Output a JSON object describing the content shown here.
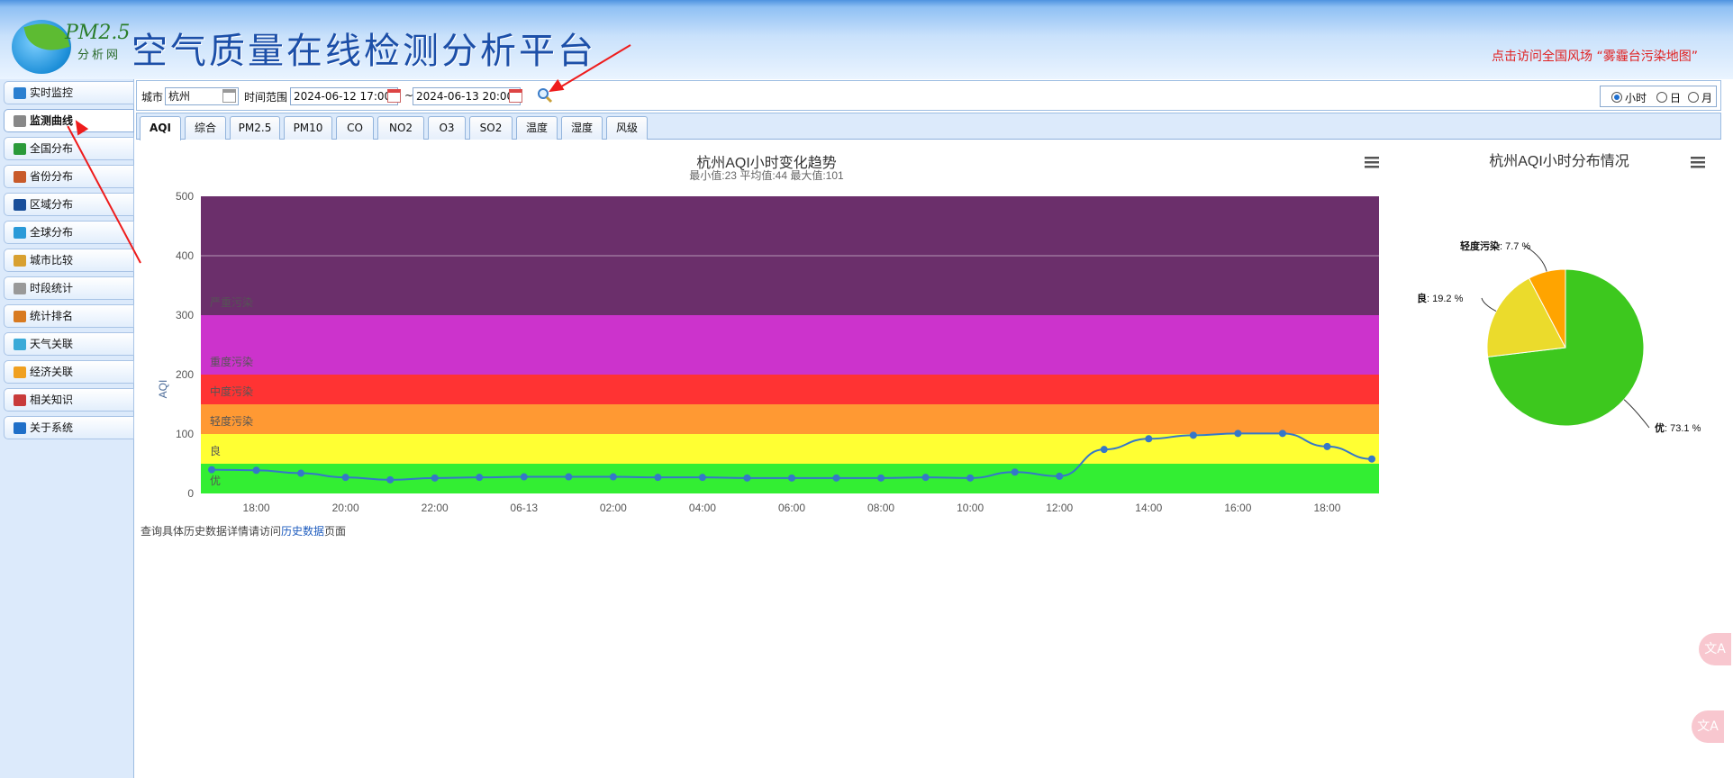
{
  "header": {
    "logo_pm": "PM2.5",
    "logo_sub": "分析网",
    "site_title": "空气质量在线检测分析平台",
    "marquee": "点击访问全国风场  “雾霾台污染地图”"
  },
  "sidebar": {
    "items": [
      {
        "label": "实时监控",
        "icon": "monitor-icon"
      },
      {
        "label": "监测曲线",
        "icon": "chart-line-icon",
        "active": true
      },
      {
        "label": "全国分布",
        "icon": "china-map-icon"
      },
      {
        "label": "省份分布",
        "icon": "province-icon"
      },
      {
        "label": "区域分布",
        "icon": "region-icon"
      },
      {
        "label": "全球分布",
        "icon": "globe-icon"
      },
      {
        "label": "城市比较",
        "icon": "scale-icon"
      },
      {
        "label": "时段统计",
        "icon": "clock-icon"
      },
      {
        "label": "统计排名",
        "icon": "ranking-icon"
      },
      {
        "label": "天气关联",
        "icon": "weather-icon"
      },
      {
        "label": "经济关联",
        "icon": "coin-icon"
      },
      {
        "label": "相关知识",
        "icon": "book-icon"
      },
      {
        "label": "关于系统",
        "icon": "info-icon"
      }
    ]
  },
  "toolbar": {
    "city_label": "城市",
    "city_value": "杭州",
    "time_label": "时间范围",
    "start_time": "2024-06-12 17:00",
    "separator": "~",
    "end_time": "2024-06-13 20:00",
    "radio_hour": "小时",
    "radio_day": "日",
    "radio_month": "月",
    "selected": "小时"
  },
  "tabs": [
    "AQI",
    "综合",
    "PM2.5",
    "PM10",
    "CO",
    "NO2",
    "O3",
    "SO2",
    "温度",
    "湿度",
    "风级"
  ],
  "active_tab": "AQI",
  "footer": {
    "prefix": "查询具体历史数据详情请访问",
    "link": "历史数据",
    "suffix": "页面"
  },
  "colors": {
    "line": "#3577c9",
    "bands": [
      "#33ee33",
      "#ffff33",
      "#ff9933",
      "#ff3333",
      "#cc33cc",
      "#6b2f6b"
    ],
    "pie": [
      "#3dc81e",
      "#ebdb2c",
      "#ffa400"
    ]
  },
  "chart_data": [
    {
      "type": "line",
      "title": "杭州AQI小时变化趋势",
      "subtitle": "最小值:23 平均值:44 最大值:101",
      "ylabel": "AQI",
      "ylim": [
        0,
        500
      ],
      "yticks": [
        0,
        100,
        200,
        300,
        400,
        500
      ],
      "xticks": [
        "18:00",
        "20:00",
        "22:00",
        "06-13",
        "02:00",
        "04:00",
        "06:00",
        "08:00",
        "10:00",
        "12:00",
        "14:00",
        "16:00",
        "18:00"
      ],
      "bands": [
        {
          "label": "优",
          "from": 0,
          "to": 50
        },
        {
          "label": "良",
          "from": 50,
          "to": 100
        },
        {
          "label": "轻度污染",
          "from": 100,
          "to": 150
        },
        {
          "label": "中度污染",
          "from": 150,
          "to": 200
        },
        {
          "label": "重度污染",
          "from": 200,
          "to": 300
        },
        {
          "label": "严重污染",
          "from": 300,
          "to": 500
        }
      ],
      "x": [
        "06-12 17:00",
        "06-12 18:00",
        "06-12 19:00",
        "06-12 20:00",
        "06-12 21:00",
        "06-12 22:00",
        "06-12 23:00",
        "06-13 00:00",
        "06-13 01:00",
        "06-13 02:00",
        "06-13 03:00",
        "06-13 04:00",
        "06-13 05:00",
        "06-13 06:00",
        "06-13 07:00",
        "06-13 08:00",
        "06-13 09:00",
        "06-13 10:00",
        "06-13 11:00",
        "06-13 12:00",
        "06-13 13:00",
        "06-13 14:00",
        "06-13 15:00",
        "06-13 16:00",
        "06-13 17:00",
        "06-13 18:00",
        "06-13 19:00"
      ],
      "series": [
        {
          "values": [
            40,
            39,
            34,
            27,
            23,
            26,
            27,
            28,
            28,
            28,
            27,
            27,
            26,
            26,
            26,
            26,
            27,
            26,
            36,
            29,
            74,
            92,
            98,
            101,
            101,
            79,
            58
          ]
        }
      ]
    },
    {
      "type": "pie",
      "title": "杭州AQI小时分布情况",
      "slices": [
        {
          "label": "优",
          "value": 73.1,
          "text": "73.1 %"
        },
        {
          "label": "良",
          "value": 19.2,
          "text": "19.2 %"
        },
        {
          "label": "轻度污染",
          "value": 7.7,
          "text": "7.7 %"
        }
      ]
    }
  ]
}
